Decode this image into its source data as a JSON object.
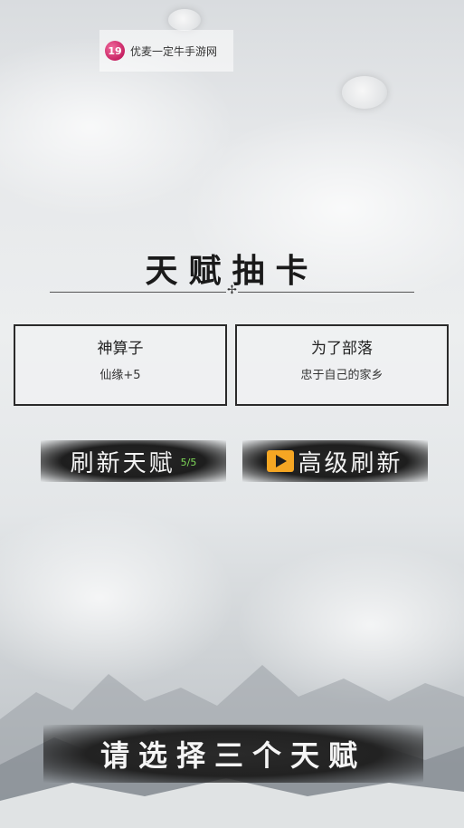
{
  "watermark": {
    "logo": "19",
    "text": "优麦一定牛手游网"
  },
  "title": "天赋抽卡",
  "cards": [
    {
      "name": "神算子",
      "desc": "仙缘+5"
    },
    {
      "name": "为了部落",
      "desc": "忠于自己的家乡"
    }
  ],
  "buttons": {
    "refresh": {
      "label": "刷新天赋",
      "count": "5/5"
    },
    "advanced": {
      "label": "高级刷新",
      "icon": "video-play-icon"
    }
  },
  "footer": "请选择三个天赋",
  "colors": {
    "accent_green": "#7ed957",
    "video_icon": "#f5a623"
  }
}
